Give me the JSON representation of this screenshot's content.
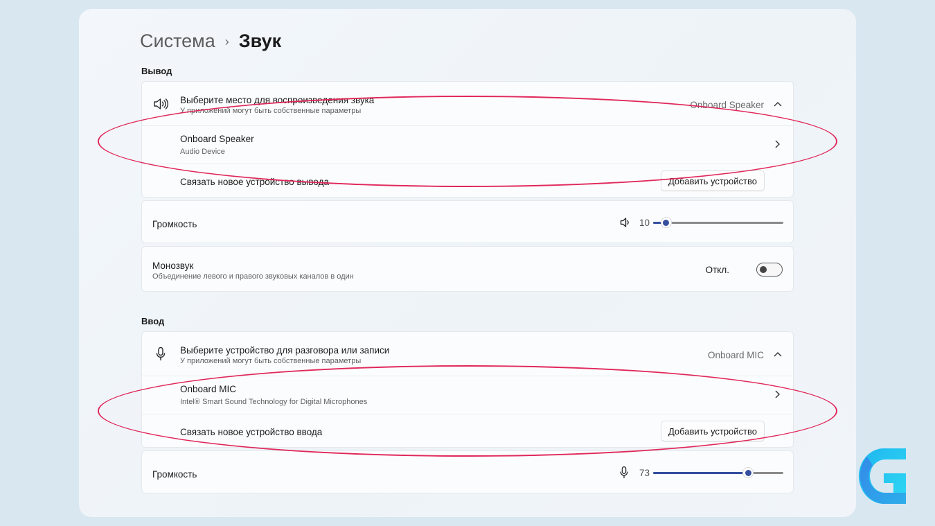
{
  "breadcrumb": {
    "parent": "Система",
    "separator": "›",
    "current": "Звук"
  },
  "output": {
    "section_title": "Вывод",
    "device_picker": {
      "title": "Выберите место для воспроизведения звука",
      "subtitle": "У приложений могут быть собственные параметры",
      "selected": "Onboard Speaker"
    },
    "device": {
      "name": "Onboard Speaker",
      "description": "Audio Device"
    },
    "pair": {
      "label": "Связать новое устройство вывода",
      "button": "Добавить устройство"
    },
    "volume": {
      "label": "Громкость",
      "value": "10",
      "level_fraction": 0.1
    },
    "mono": {
      "title": "Монозвук",
      "subtitle": "Объединение левого и правого звуковых каналов в один",
      "state": "Откл."
    }
  },
  "input": {
    "section_title": "Ввод",
    "device_picker": {
      "title": "Выберите устройство для разговора или записи",
      "subtitle": "У приложений могут быть собственные параметры",
      "selected": "Onboard MIC"
    },
    "device": {
      "name": "Onboard MIC",
      "description": "Intel® Smart Sound Technology for Digital Microphones"
    },
    "pair": {
      "label": "Связать новое устройство ввода",
      "button": "Добавить устройство"
    },
    "volume": {
      "label": "Громкость",
      "value": "73",
      "level_fraction": 0.73
    }
  },
  "icons": {
    "speaker": "speaker-icon",
    "microphone": "microphone-icon",
    "chevron_up": "chevron-up-icon",
    "chevron_right": "chevron-right-icon",
    "logo": "g-logo-icon"
  },
  "colors": {
    "accent": "#354f9e",
    "annotation": "#e1285a",
    "background": "#d9e7f1"
  }
}
